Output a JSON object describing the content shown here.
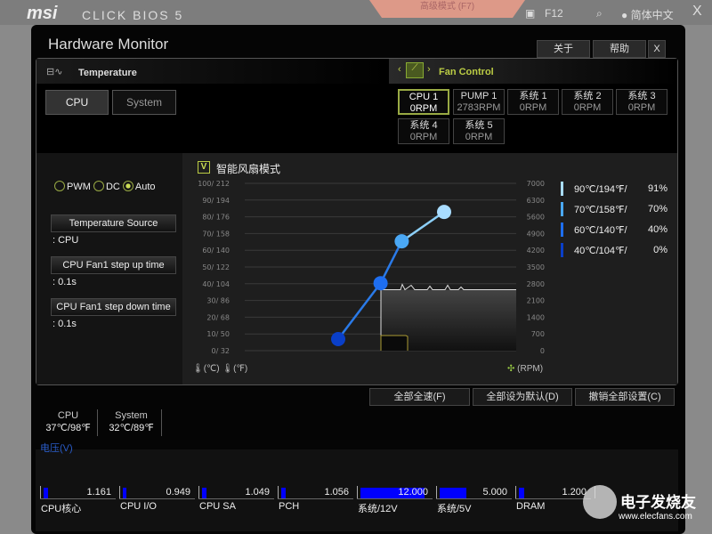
{
  "app": {
    "logo": "msi",
    "title": "CLICK BIOS 5",
    "mode_tab": "高级模式 (F7)",
    "screenshot_key": "F12",
    "language": "简体中文",
    "close": "X"
  },
  "window": {
    "title": "Hardware Monitor",
    "buttons": {
      "about": "关于",
      "help": "帮助",
      "close": "X"
    }
  },
  "temperature": {
    "header": "Temperature",
    "tabs": [
      "CPU",
      "System"
    ],
    "selected": "CPU"
  },
  "fan_control": {
    "header": "Fan Control",
    "fans": [
      {
        "name": "CPU 1",
        "rpm": "0RPM",
        "selected": true
      },
      {
        "name": "PUMP 1",
        "rpm": "2783RPM"
      },
      {
        "name": "系统 1",
        "rpm": "0RPM"
      },
      {
        "name": "系统 2",
        "rpm": "0RPM"
      },
      {
        "name": "系统 3",
        "rpm": "0RPM"
      },
      {
        "name": "系统 4",
        "rpm": "0RPM"
      },
      {
        "name": "系统 5",
        "rpm": "0RPM"
      }
    ]
  },
  "mode": {
    "options": [
      "PWM",
      "DC",
      "Auto"
    ],
    "selected": "Auto"
  },
  "settings": [
    {
      "label": "Temperature Source",
      "value": ": CPU"
    },
    {
      "label": "CPU Fan1 step up time",
      "value": ": 0.1s"
    },
    {
      "label": "CPU Fan1 step down time",
      "value": ": 0.1s"
    }
  ],
  "smart_fan": {
    "label": "智能风扇模式",
    "checked": true,
    "check_glyph": "V"
  },
  "chart_data": {
    "type": "line",
    "left_ticks": [
      "100/ 212",
      "90/ 194",
      "80/ 176",
      "70/ 158",
      "60/ 140",
      "50/ 122",
      "40/ 104",
      "30/  86",
      "20/  68",
      "10/  50",
      "0/  32"
    ],
    "right_ticks": [
      "7000",
      "6300",
      "5600",
      "4900",
      "4200",
      "3500",
      "2800",
      "2100",
      "1400",
      "700",
      "0"
    ],
    "left_unit_c": "(℃)",
    "left_unit_f": "(℉)",
    "right_unit": "(RPM)",
    "points": [
      {
        "temp_c": 40,
        "percent": 0
      },
      {
        "temp_c": 60,
        "percent": 40
      },
      {
        "temp_c": 70,
        "percent": 70
      },
      {
        "temp_c": 90,
        "percent": 91
      }
    ],
    "current_rpm_level": 2550,
    "point_colors": [
      "#0a3fc8",
      "#1e6ef0",
      "#4aa8f5",
      "#a8dcff"
    ]
  },
  "legend": [
    {
      "temp": "90℃/194℉/",
      "pct": "91%",
      "color": "#a8dcff"
    },
    {
      "temp": "70℃/158℉/",
      "pct": "70%",
      "color": "#4aa8f5"
    },
    {
      "temp": "60℃/140℉/",
      "pct": "40%",
      "color": "#1e6ef0"
    },
    {
      "temp": "40℃/104℉/",
      "pct": "0%",
      "color": "#0a3fc8"
    }
  ],
  "actions": [
    "全部全速(F)",
    "全部设为默认(D)",
    "撤销全部设置(C)"
  ],
  "temps": [
    {
      "name": "CPU",
      "value": "37℃/98℉"
    },
    {
      "name": "System",
      "value": "32℃/89℉"
    }
  ],
  "voltage": {
    "title": "电压(V)",
    "items": [
      {
        "name": "CPU核心",
        "value": "1.161",
        "fill": 0.07
      },
      {
        "name": "CPU I/O",
        "value": "0.949",
        "fill": 0.06
      },
      {
        "name": "CPU SA",
        "value": "1.049",
        "fill": 0.07
      },
      {
        "name": "PCH",
        "value": "1.056",
        "fill": 0.07
      },
      {
        "name": "系统/12V",
        "value": "12.000",
        "fill": 1
      },
      {
        "name": "系统/5V",
        "value": "5.000",
        "fill": 0.42
      },
      {
        "name": "DRAM",
        "value": "1.200",
        "fill": 0.08
      }
    ]
  },
  "watermark": {
    "brand": "电子发烧友",
    "url": "www.elecfans.com"
  }
}
